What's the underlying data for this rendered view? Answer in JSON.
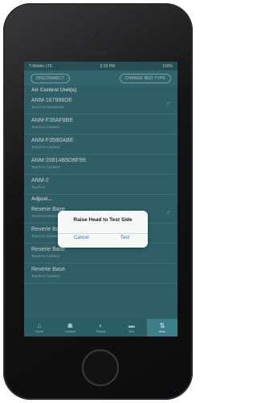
{
  "status": {
    "carrier": "T-Mobile LTE",
    "time": "3:19 PM",
    "battery": "100%"
  },
  "toolbar": {
    "disconnect": "DISCONNECT",
    "change_bed": "CHANGE BED TYPE"
  },
  "sections": {
    "air": "Air Control Unit(s)",
    "adjust": "Adjust..."
  },
  "devices": [
    {
      "name": "ANM-167996DE",
      "sub": "Touch to Disconnect",
      "checked": true
    },
    {
      "name": "ANM-F35AF8BE",
      "sub": "Touch to Connect",
      "checked": false
    },
    {
      "name": "ANM-F35B0ABE",
      "sub": "Touch to Connect",
      "checked": false
    },
    {
      "name": "ANM-20814B5DBF99",
      "sub": "Touch to Connect",
      "checked": false
    },
    {
      "name": "ANM-2",
      "sub": "Touch to",
      "checked": false
    }
  ],
  "bases": [
    {
      "name": "Reverie Base",
      "sub": "Touch to Disconnect",
      "checked": true
    },
    {
      "name": "Reverie Base",
      "sub": "Touch to Connect",
      "checked": false
    },
    {
      "name": "Reverie Base",
      "sub": "Touch to Connect",
      "checked": false
    },
    {
      "name": "Reverie Base",
      "sub": "Touch to Connect",
      "checked": false
    }
  ],
  "dialog": {
    "title": "Raise Head to Test Side",
    "cancel": "Cancel",
    "test": "Test"
  },
  "tabs": [
    {
      "label": "Home",
      "icon": "home-icon",
      "glyph": "⌂"
    },
    {
      "label": "Comfort",
      "icon": "car-seat-icon",
      "glyph": "☗"
    },
    {
      "label": "Presets",
      "icon": "moon-icon",
      "glyph": "◐"
    },
    {
      "label": "Bed",
      "icon": "bed-icon",
      "glyph": "▬"
    },
    {
      "label": "More",
      "icon": "sliders-icon",
      "glyph": "⇅",
      "active": true
    }
  ],
  "colors": {
    "accent": "#3b7882",
    "dialog_button": "#2f72b4"
  }
}
